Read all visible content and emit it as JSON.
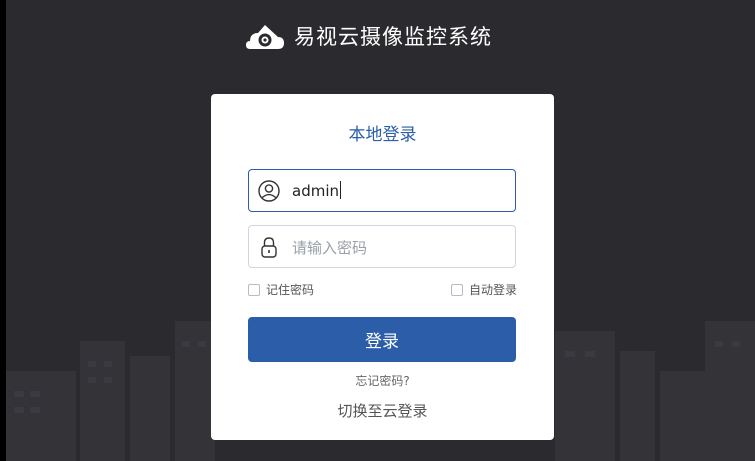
{
  "brand": {
    "title": "易视云摄像监控系统",
    "logo_icon": "house-camera-icon"
  },
  "login": {
    "title": "本地登录",
    "username": {
      "value": "admin",
      "icon": "user-icon"
    },
    "password": {
      "placeholder": "请输入密码",
      "icon": "lock-icon"
    },
    "remember_label": "记住密码",
    "auto_login_label": "自动登录",
    "submit_label": "登录",
    "forgot_label": "忘记密码?",
    "switch_label": "切换至云登录"
  },
  "colors": {
    "background": "#2b2b2f",
    "accent": "#2b5da8",
    "card": "#ffffff"
  }
}
